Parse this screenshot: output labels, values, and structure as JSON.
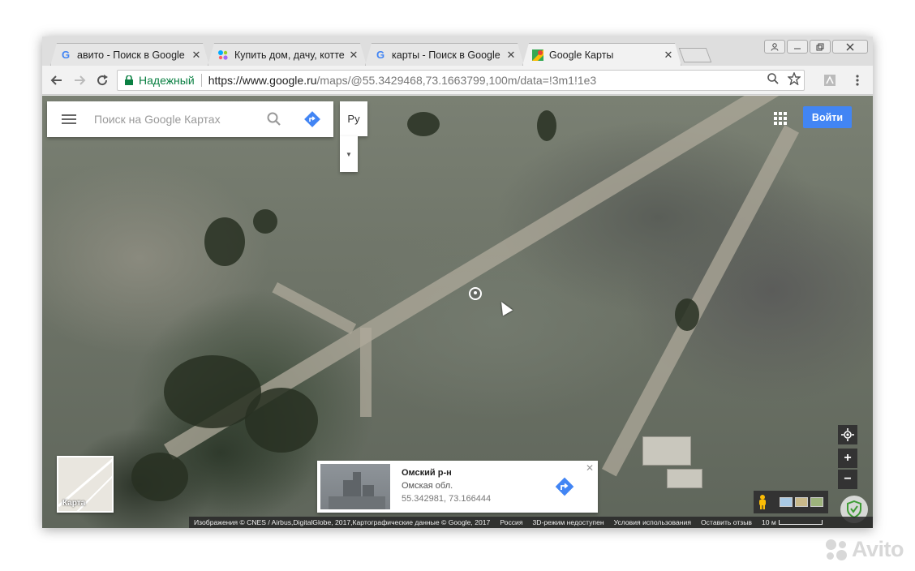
{
  "tabs": [
    {
      "title": "авито - Поиск в Google",
      "icon": "google-g-icon",
      "active": false
    },
    {
      "title": "Купить дом, дачу, котте",
      "icon": "avito-dots-icon",
      "active": false
    },
    {
      "title": "карты - Поиск в Google",
      "icon": "google-g-icon",
      "active": false
    },
    {
      "title": "Google Карты",
      "icon": "google-maps-icon",
      "active": true
    }
  ],
  "tab_close_glyph": "✕",
  "omnibox": {
    "secure_label": "Надежный",
    "url_host": "https://www.google.ru",
    "url_path": "/maps/@55.3429468,73.1663799,100m/data=!3m1!1e3"
  },
  "maps": {
    "search_placeholder": "Поиск на Google Картах",
    "language_button": "Ру",
    "signin_label": "Войти",
    "info_card": {
      "name": "Омский р-н",
      "region": "Омская обл.",
      "coords": "55.342981, 73.166444"
    },
    "minimap_label": "Карта",
    "zoom_in": "+",
    "zoom_out": "−",
    "footer": {
      "imagery": "Изображения © CNES / Airbus,DigitalGlobe, 2017,Картографические данные © Google, 2017",
      "country": "Россия",
      "mode_3d": "3D-режим недоступен",
      "terms": "Условия использования",
      "feedback": "Оставить отзыв",
      "scale": "10 м"
    }
  },
  "watermark": "Avito",
  "colors": {
    "accent_blue": "#4285f4",
    "secure_green": "#0b8043"
  }
}
